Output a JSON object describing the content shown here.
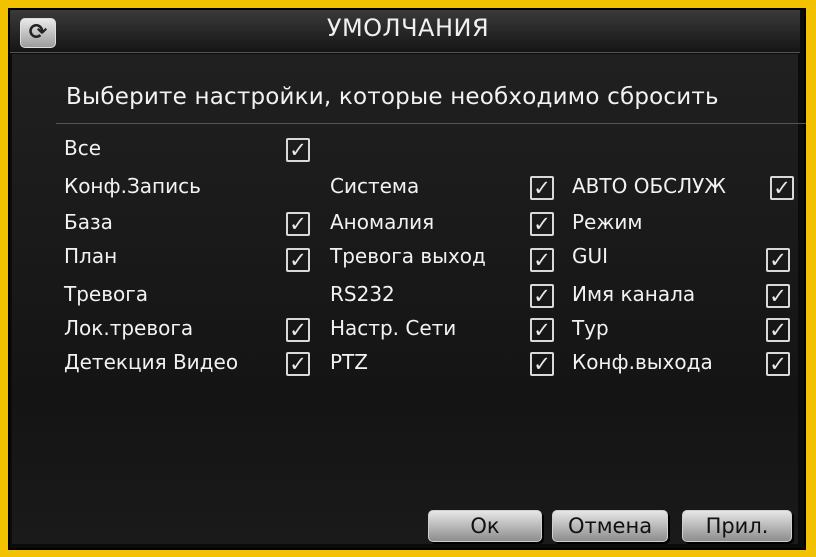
{
  "dialog": {
    "title": "УМОЛЧАНИЯ",
    "refresh_icon": "refresh-icon"
  },
  "prompt": "Выберите настройки, которые необходимо сбросить",
  "options": {
    "all": "Все",
    "conf_record": "Конф.Запись",
    "base": "База",
    "plan": "План",
    "alarm": "Тревога",
    "local_alarm": "Лок.тревога",
    "video_detect": "Детекция Видео",
    "system": "Система",
    "anomaly": "Аномалия",
    "alarm_output": "Тревога выход",
    "rs232": "RS232",
    "network": "Настр. Сети",
    "ptz": "PTZ",
    "auto_maintain": "АВТО ОБСЛУЖ",
    "mode": "Режим",
    "gui": "GUI",
    "channel_name": "Имя канала",
    "tour": "Тур",
    "output_conf": "Конф.выхода"
  },
  "checkbox_mark": "✓",
  "buttons": {
    "ok": "Ок",
    "cancel": "Отмена",
    "apply": "Прил."
  }
}
